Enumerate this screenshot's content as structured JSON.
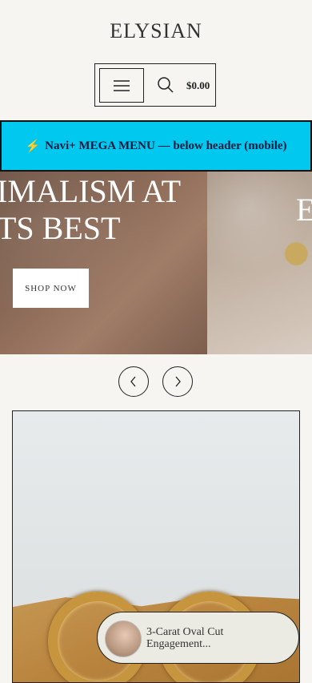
{
  "header": {
    "logo": "ELYSIAN",
    "menu_icon": "hamburger-icon",
    "search_icon": "search-icon",
    "cart_total": "$0.00"
  },
  "mega_menu": {
    "icon": "⚡",
    "label": "Navi+ MEGA MENU — below header (mobile)"
  },
  "hero": {
    "slide1_heading": "IMALISM AT\nTS BEST",
    "slide1_button": "SHOP NOW",
    "slide2_heading": "E"
  },
  "carousel": {
    "prev_icon": "chevron-left-icon",
    "next_icon": "chevron-right-icon"
  },
  "popup": {
    "title": "3-Carat Oval Cut Engagement..."
  },
  "colors": {
    "background": "#f6f5f2",
    "mega_menu_bg": "#00c8ee",
    "popup_bg": "#ecebe3"
  }
}
